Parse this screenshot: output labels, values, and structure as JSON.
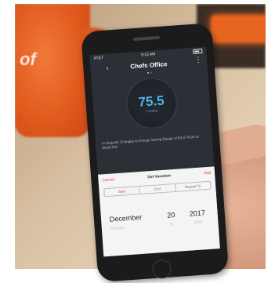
{
  "status": {
    "carrier": "AT&T",
    "time": "9:15 AM"
  },
  "header": {
    "title": "Chefs Office"
  },
  "thermostat": {
    "temperature": "75.5",
    "mode": "Cooling"
  },
  "notice": "In Setpoint Changes to Energy Saving Range of 64.0-78.00 at 06:00 PM",
  "sheet": {
    "cancel_label": "Cancel",
    "title": "Set Vacation",
    "add_label": "Add",
    "segments": [
      "Start",
      "End",
      "Repeat To"
    ]
  },
  "picker": {
    "selected": {
      "month": "December",
      "day": "20",
      "year": "2017"
    },
    "below": {
      "month": "January",
      "day": "21",
      "year": "2018"
    }
  },
  "photo": {
    "mug_text": "of"
  }
}
